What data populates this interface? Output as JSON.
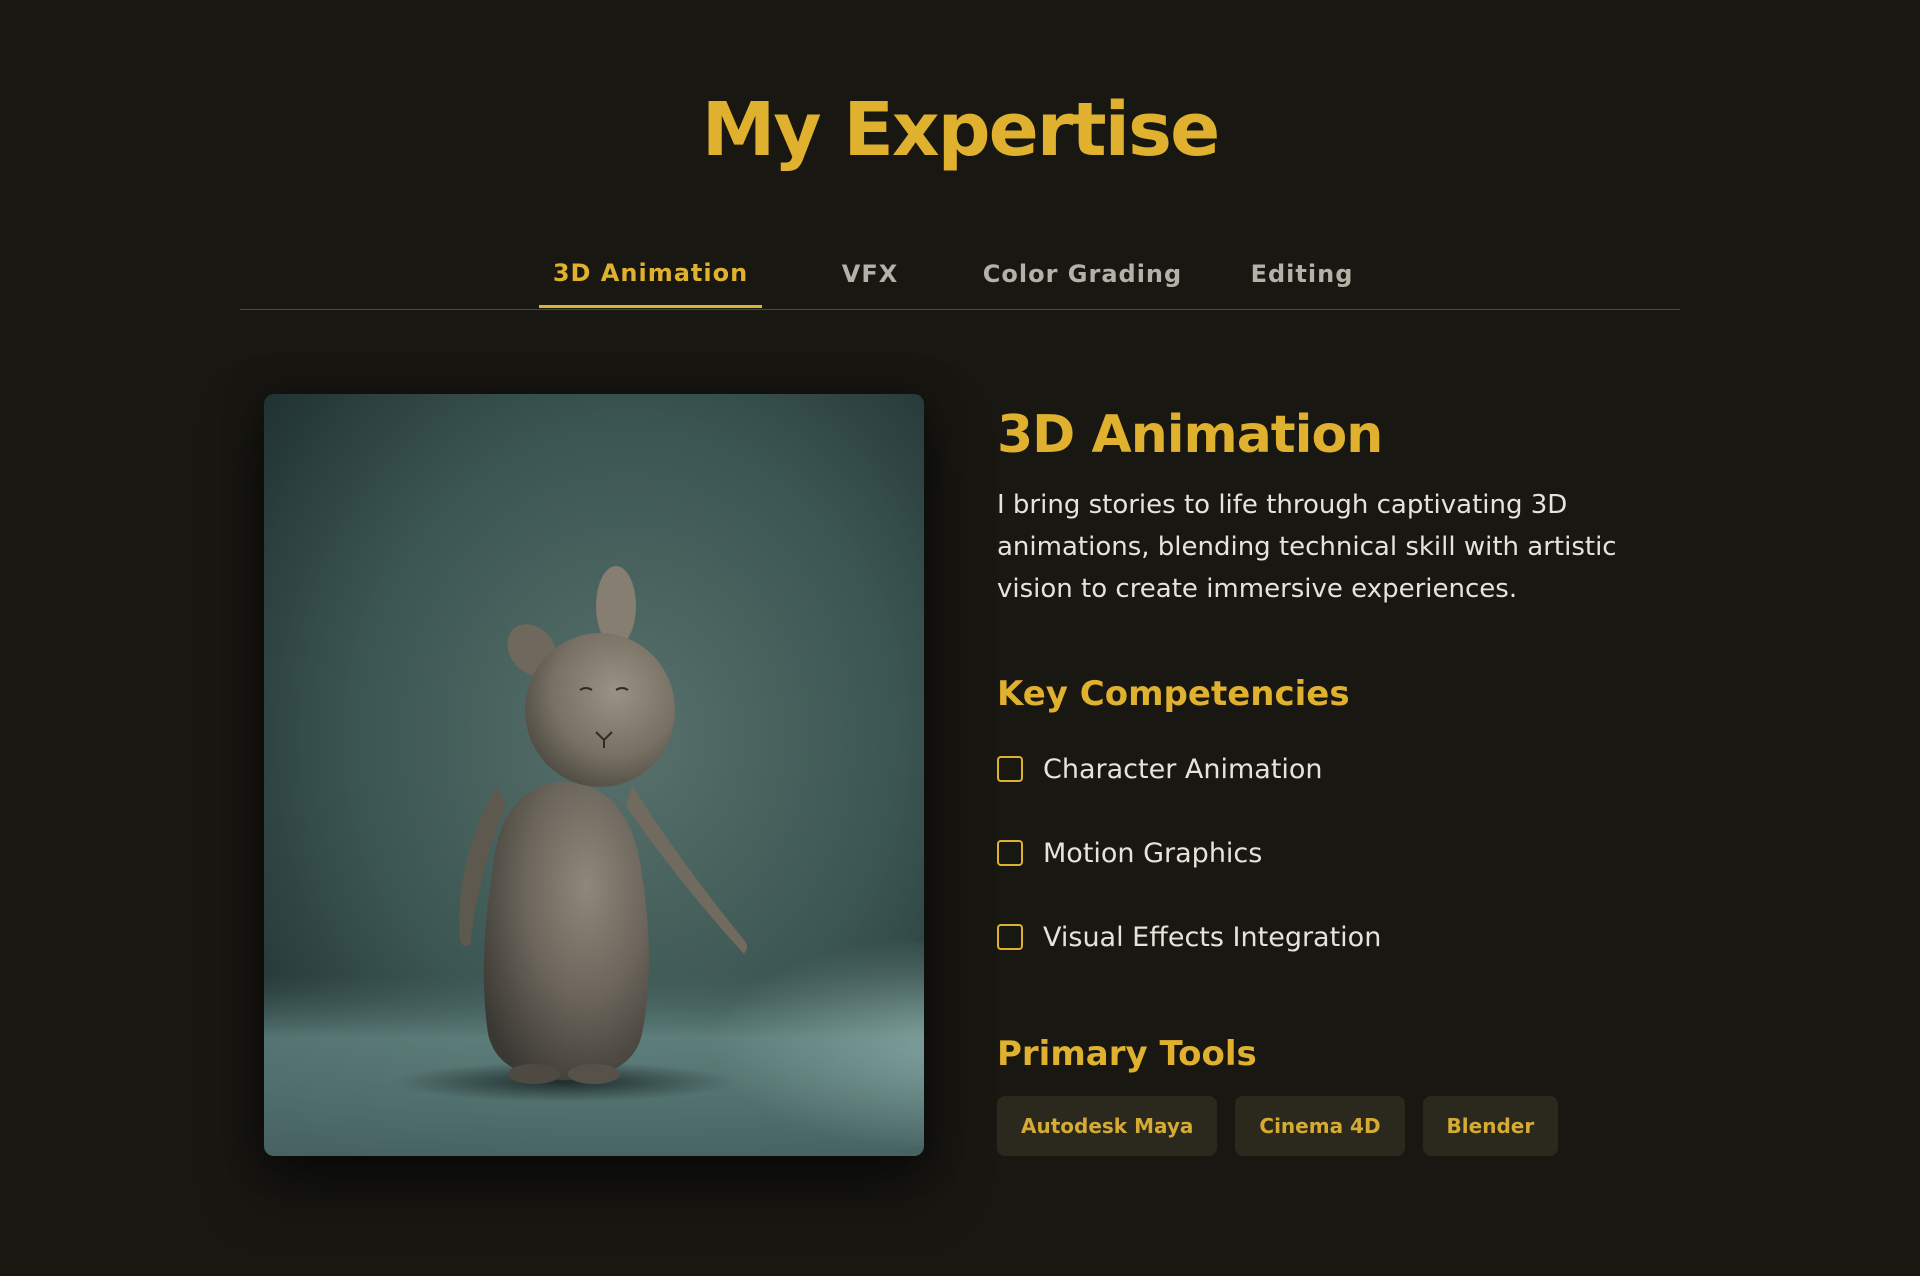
{
  "page": {
    "title": "My Expertise"
  },
  "tabs": [
    {
      "label": "3D Animation",
      "active": true
    },
    {
      "label": "VFX",
      "active": false
    },
    {
      "label": "Color Grading",
      "active": false
    },
    {
      "label": "Editing",
      "active": false
    }
  ],
  "content": {
    "image_icon": "rabbit-figure-render",
    "title": "3D Animation",
    "description": "I bring stories to life through captivating 3D animations, blending technical skill with artistic vision to create immersive experiences.",
    "competencies": {
      "heading": "Key Competencies",
      "items": [
        {
          "label": "Character Animation",
          "checked": false
        },
        {
          "label": "Motion Graphics",
          "checked": false
        },
        {
          "label": "Visual Effects Integration",
          "checked": false
        }
      ]
    },
    "tools": {
      "heading": "Primary Tools",
      "items": [
        "Autodesk Maya",
        "Cinema 4D",
        "Blender"
      ]
    }
  },
  "colors": {
    "background": "#181712",
    "accent": "#e0b12e",
    "text": "#e6e3da",
    "muted_tab": "#b4b1a7",
    "chip_bg": "#2b291e"
  }
}
